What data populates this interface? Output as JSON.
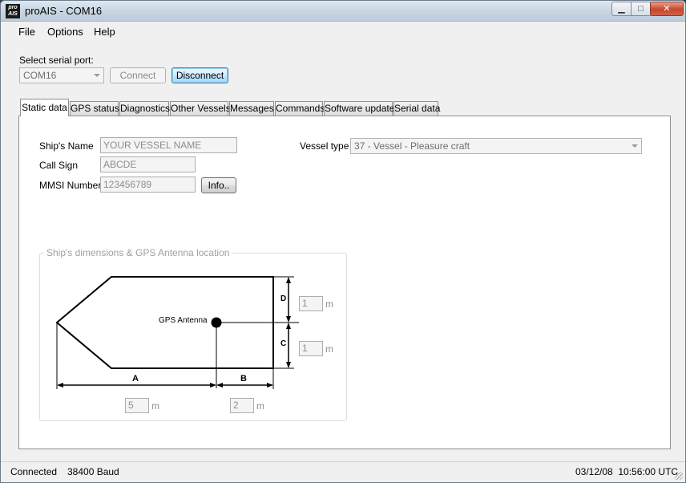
{
  "window": {
    "title": "proAIS - COM16",
    "app_icon_text": "pro AIS",
    "minimize": "▁",
    "maximize": "□",
    "close": "✕"
  },
  "menu": {
    "file": "File",
    "options": "Options",
    "help": "Help"
  },
  "serial": {
    "label": "Select serial port:",
    "port": "COM16",
    "connect_label": "Connect",
    "disconnect_label": "Disconnect"
  },
  "tabs": [
    {
      "label": "Static data",
      "active": true
    },
    {
      "label": "GPS status"
    },
    {
      "label": "Diagnostics"
    },
    {
      "label": "Other Vessels"
    },
    {
      "label": "Messages"
    },
    {
      "label": "Commands"
    },
    {
      "label": "Software update"
    },
    {
      "label": "Serial data"
    }
  ],
  "static": {
    "ship_name_label": "Ship's Name",
    "ship_name_value": "YOUR VESSEL NAME",
    "call_sign_label": "Call Sign",
    "call_sign_value": "ABCDE",
    "mmsi_label": "MMSI Number",
    "mmsi_value": "123456789",
    "info_button": "Info..",
    "vessel_type_label": "Vessel type",
    "vessel_type_value": "37 -  Vessel - Pleasure craft"
  },
  "dimensions": {
    "group_title": "Ship's dimensions & GPS Antenna location",
    "gps_label": "GPS Antenna",
    "label_a": "A",
    "label_b": "B",
    "label_c": "C",
    "label_d": "D",
    "d_value": "1",
    "c_value": "1",
    "a_value": "5",
    "b_value": "2",
    "unit": "m"
  },
  "status": {
    "connection": "Connected",
    "baud": "38400 Baud",
    "datetime": "03/12/08  10:56:00 UTC"
  }
}
